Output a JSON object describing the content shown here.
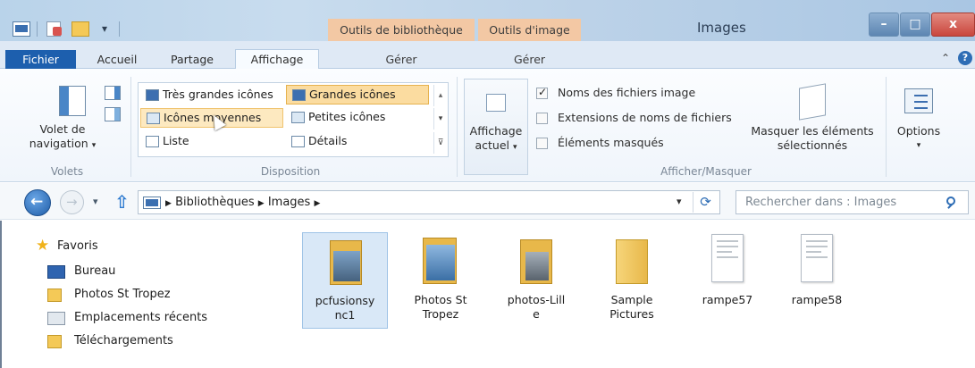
{
  "window": {
    "title": "Images",
    "context_tab_library": "Outils de bibliothèque",
    "context_tab_image": "Outils d'image",
    "minimize": "–",
    "maximize": "□",
    "close": "x"
  },
  "tabs": {
    "file": "Fichier",
    "home": "Accueil",
    "share": "Partage",
    "view": "Affichage",
    "manage_library": "Gérer",
    "manage_image": "Gérer"
  },
  "ribbon": {
    "nav_pane_line1": "Volet de",
    "nav_pane_line2": "navigation",
    "group_panes": "Volets",
    "layout": {
      "extra_large": "Très grandes icônes",
      "large": "Grandes icônes",
      "medium": "Icônes moyennes",
      "small": "Petites icônes",
      "list": "Liste",
      "details": "Détails"
    },
    "group_layout": "Disposition",
    "current_view_line1": "Affichage",
    "current_view_line2": "actuel",
    "checkbox_names": "Noms des fichiers image",
    "checkbox_extensions": "Extensions de noms de fichiers",
    "checkbox_hidden": "Éléments masqués",
    "hide_selected_line1": "Masquer les éléments",
    "hide_selected_line2": "sélectionnés",
    "group_show_hide": "Afficher/Masquer",
    "options": "Options",
    "checked_names": true,
    "checked_extensions": false,
    "checked_hidden": false
  },
  "address": {
    "crumb1": "Bibliothèques",
    "crumb2": "Images",
    "search_placeholder": "Rechercher dans : Images"
  },
  "nav_pane": {
    "favorites": "Favoris",
    "items": [
      "Bureau",
      "Photos St Tropez",
      "Emplacements récents",
      "Téléchargements"
    ]
  },
  "files": [
    {
      "line1": "pcfusionsy",
      "line2": "nc1",
      "type": "photo-folder",
      "selected": true
    },
    {
      "line1": "Photos St",
      "line2": "Tropez",
      "type": "photo-folder",
      "selected": false
    },
    {
      "line1": "photos-Lill",
      "line2": "e",
      "type": "photo-folder",
      "selected": false
    },
    {
      "line1": "Sample",
      "line2": "Pictures",
      "type": "folder",
      "selected": false
    },
    {
      "line1": "rampe57",
      "line2": "",
      "type": "document",
      "selected": false
    },
    {
      "line1": "rampe58",
      "line2": "",
      "type": "document",
      "selected": false
    }
  ],
  "colors": {
    "file_tab": "#1d5fae",
    "context_tab": "#f3c8a4",
    "selection": "#d9e8f7",
    "close_button": "#c9463d"
  }
}
